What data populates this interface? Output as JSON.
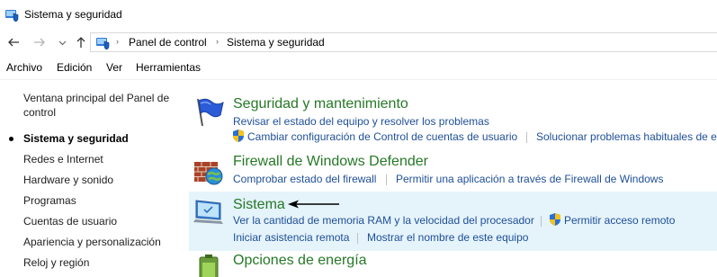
{
  "window": {
    "title": "Sistema y seguridad"
  },
  "address": {
    "crumbs": [
      "Panel de control",
      "Sistema y seguridad"
    ]
  },
  "menu": [
    "Archivo",
    "Edición",
    "Ver",
    "Herramientas"
  ],
  "leftnav": {
    "items": [
      "Ventana principal del Panel de control",
      "Sistema y seguridad",
      "Redes e Internet",
      "Hardware y sonido",
      "Programas",
      "Cuentas de usuario",
      "Apariencia y personalización",
      "Reloj y región"
    ],
    "current_index": 1
  },
  "sections": [
    {
      "title": "Seguridad y mantenimiento",
      "icon": "flag-icon",
      "tasks": [
        "Revisar el estado del equipo y resolver los problemas",
        "Cambiar configuración de Control de cuentas de usuario",
        "Solucionar problemas habituales de e"
      ]
    },
    {
      "title": "Firewall de Windows Defender",
      "icon": "firewall-icon",
      "tasks": [
        "Comprobar estado del firewall",
        "Permitir una aplicación a través de Firewall de Windows"
      ]
    },
    {
      "title": "Sistema",
      "icon": "system-monitor-icon",
      "highlighted": true,
      "tasks": [
        "Ver la cantidad de memoria RAM y la velocidad del procesador",
        "Permitir acceso remoto",
        "Iniciar asistencia remota",
        "Mostrar el nombre de este equipo"
      ]
    },
    {
      "title": "Opciones de energía",
      "icon": "power-battery-icon",
      "tasks": []
    }
  ],
  "colors": {
    "section_title": "#267826",
    "link": "#1e4f97",
    "highlight": "#e5f3fb",
    "annotation_arrow": "#000000"
  }
}
